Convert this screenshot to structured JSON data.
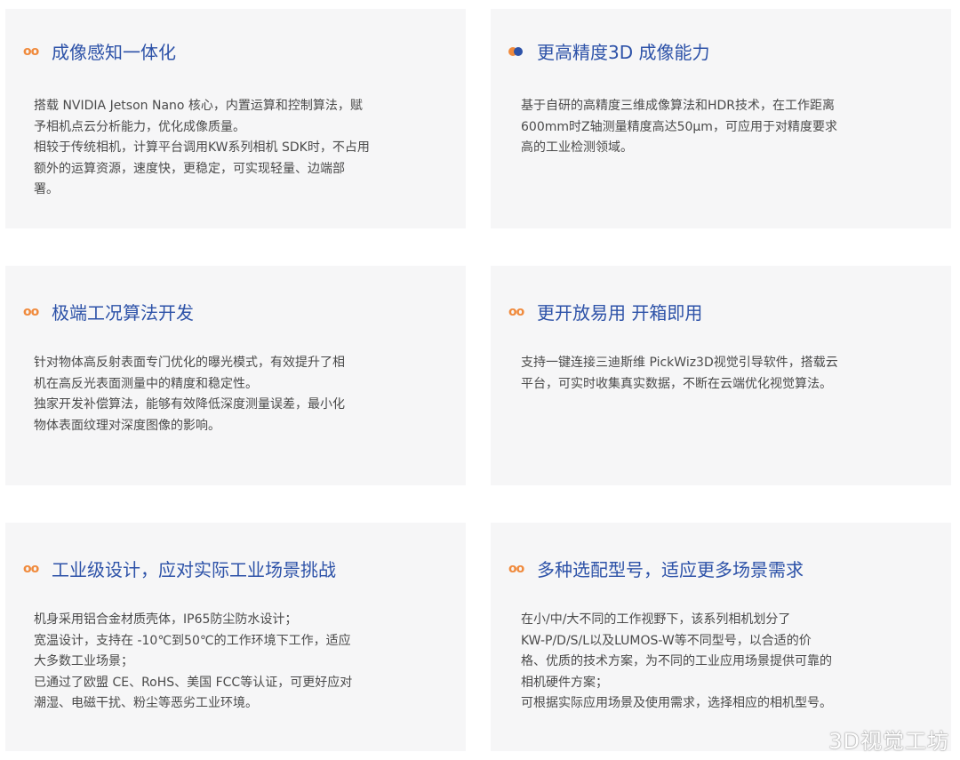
{
  "cards": [
    {
      "marker": "oo",
      "title": "成像感知一体化",
      "lines": [
        "搭载 NVIDIA Jetson Nano 核心，内置运算和控制算法，赋",
        "予相机点云分析能力，优化成像质量。",
        "相较于传统相机，计算平台调用KW系列相机 SDK时，不占用",
        "额外的运算资源，速度快，更稳定，可实现轻量、边端部",
        "署。"
      ]
    },
    {
      "marker": "",
      "title": "更高精度3D 成像能力",
      "lines": [
        "基于自研的高精度三维成像算法和HDR技术，在工作距离",
        "600mm时Z轴测量精度高达50μm，可应用于对精度要求",
        "高的工业检测领域。"
      ]
    },
    {
      "marker": "oo",
      "title": "极端工况算法开发",
      "lines": [
        "针对物体高反射表面专门优化的曝光模式，有效提升了相",
        "机在高反光表面测量中的精度和稳定性。",
        "独家开发补偿算法，能够有效降低深度测量误差，最小化",
        "物体表面纹理对深度图像的影响。"
      ]
    },
    {
      "marker": "oo",
      "title": "更开放易用 开箱即用",
      "lines": [
        "支持一键连接三迪斯维 PickWiz3D视觉引导软件，搭载云",
        "平台，可实时收集真实数据，不断在云端优化视觉算法。"
      ]
    },
    {
      "marker": "oo",
      "title": "工业级设计，应对实际工业场景挑战",
      "lines": [
        "机身采用铝合金材质壳体，IP65防尘防水设计；",
        "宽温设计，支持在 -10℃到50℃的工作环境下工作，适应",
        "大多数工业场景；",
        "已通过了欧盟 CE、RoHS、美国 FCC等认证，可更好应对",
        "潮湿、电磁干扰、粉尘等恶劣工业环境。"
      ]
    },
    {
      "marker": "oo",
      "title": "多种选配型号，适应更多场景需求",
      "lines": [
        "在小/中/大不同的工作视野下，该系列相机划分了",
        "KW-P/D/S/L以及LUMOS-W等不同型号，以合适的价",
        "格、优质的技术方案，为不同的工业应用场景提供可靠的",
        "相机硬件方案；",
        "可根据实际应用场景及使用需求，选择相应的相机型号。"
      ]
    }
  ],
  "watermark": "3D视觉工坊",
  "colors": {
    "accent": "#f08a3c",
    "title": "#2d52a8",
    "card_bg": "#f6f6f7",
    "text": "#4a4a4a"
  }
}
